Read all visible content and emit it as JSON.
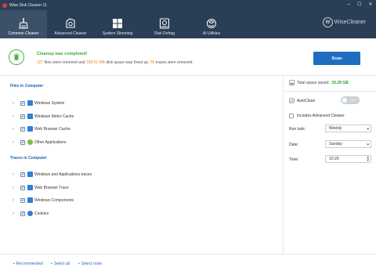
{
  "window": {
    "title": "Wise Disk Cleaner 11",
    "controls": [
      "─",
      "☐",
      "✕"
    ]
  },
  "toolbar": {
    "tabs": [
      {
        "label": "Common Cleaner",
        "icon": "broom-icon",
        "active": true
      },
      {
        "label": "Advanced Cleaner",
        "icon": "advanced-cleaner-icon",
        "active": false
      },
      {
        "label": "System Slimming",
        "icon": "windows-icon",
        "active": false
      },
      {
        "label": "Disk Defrag",
        "icon": "disk-defrag-icon",
        "active": false
      },
      {
        "label": "AI Utilities",
        "icon": "ai-utilities-icon",
        "active": false
      }
    ],
    "brand_letter": "W",
    "brand_text": "WiseCleaner"
  },
  "result": {
    "title": "Cleanup was completed!",
    "files_count": "327",
    "files_text": " files were removed and ",
    "space_amount": "238.01 MB",
    "space_text": " disk space was freed up. ",
    "traces_count": "56",
    "traces_text": " traces were removed.",
    "scan_label": "Scan"
  },
  "files_section": {
    "title": "Files in Computer",
    "items": [
      {
        "label": "Windows System",
        "color": "#2f7fd6"
      },
      {
        "label": "Windows Metro Cache",
        "color": "#2f7fd6"
      },
      {
        "label": "Web Browser Cache",
        "color": "#2f7fd6"
      },
      {
        "label": "Other Applications",
        "color": "#7bbf3a"
      }
    ]
  },
  "traces_section": {
    "title": "Traces in Computer",
    "items": [
      {
        "label": "Windows and Applications traces",
        "color": "#2f7fd6"
      },
      {
        "label": "Web Browser Trace",
        "color": "#2f7fd6"
      },
      {
        "label": "Windows Components",
        "color": "#2f7fd6"
      },
      {
        "label": "Cookies",
        "color": "#3a7bc8"
      }
    ]
  },
  "schedule": {
    "saved_label": "Total space saved:",
    "saved_value": "20.29 GB",
    "autoclean_label": "AutoClean",
    "autoclean_state": "OFF",
    "advanced_label": "Includes Advanced Cleaner",
    "run_task_label": "Run task:",
    "run_task_value": "Weekly",
    "date_label": "Date:",
    "date_value": "Sunday",
    "time_label": "Time:",
    "time_value": "10:29"
  },
  "footer": {
    "recommended": "Recommended",
    "select_all": "Select all",
    "select_none": "Select none"
  },
  "colors": {
    "topbar": "#2a3f55",
    "accent_blue": "#1f6dc1",
    "success_green": "#3ea63a",
    "highlight_orange": "#e8852a"
  }
}
